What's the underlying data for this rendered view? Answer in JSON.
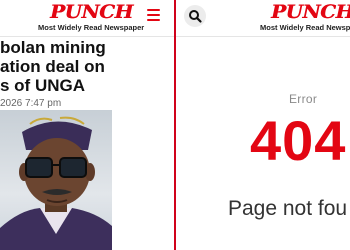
{
  "left_panel": {
    "brand": "PUNCH",
    "tagline": "Most Widely Read Newspaper",
    "menu_icon": "hamburger-menu-icon",
    "headline_lines": [
      "bolan mining",
      "ation deal on",
      "s of UNGA"
    ],
    "dateline": "2026 7:47 pm",
    "photo_alt": "portrait photo"
  },
  "right_panel": {
    "search_icon": "search-icon",
    "brand": "PUNCH",
    "tagline": "Most Widely Read Newspaper",
    "error_label": "Error",
    "error_code": "404",
    "error_message": "Page not fou"
  },
  "colors": {
    "brand_red": "#e30613",
    "divider_red": "#d0021b",
    "text_dark": "#111111",
    "text_muted": "#8a8a8a"
  }
}
